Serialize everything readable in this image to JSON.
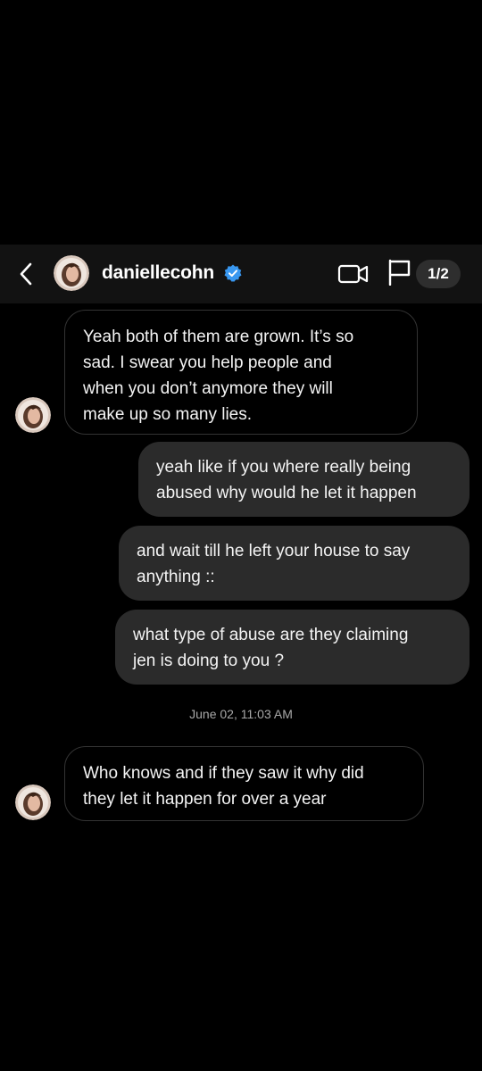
{
  "header": {
    "back_icon": "chevron-left-icon",
    "username": "daniellecohn",
    "verified_icon": "verified-badge-icon",
    "video_icon": "video-camera-icon",
    "flag_icon": "flag-icon",
    "page_indicator": "1/2"
  },
  "messages": [
    {
      "direction": "incoming",
      "lines": [
        "Yeah both of them are grown.  It’s so",
        "sad.  I swear you help people and",
        "when you don’t anymore they will",
        "make up so many lies."
      ]
    },
    {
      "direction": "outgoing",
      "lines": [
        "yeah like if you where really being",
        "abused why would he let it happen"
      ]
    },
    {
      "direction": "outgoing",
      "lines": [
        "and wait till he left your house to say",
        "anything ::"
      ]
    },
    {
      "direction": "outgoing",
      "lines": [
        "what type of abuse are they claiming",
        "jen is doing to you ?"
      ]
    },
    {
      "direction": "incoming",
      "lines": [
        "Who knows and if they saw it why did",
        "they let it happen for over a year"
      ]
    }
  ],
  "timestamp": "June 02, 11:03 AM",
  "colors": {
    "background": "#000000",
    "header": "#121212",
    "outgoing_bubble": "#2b2b2b",
    "incoming_border": "#333333",
    "verified": "#3897f0"
  }
}
